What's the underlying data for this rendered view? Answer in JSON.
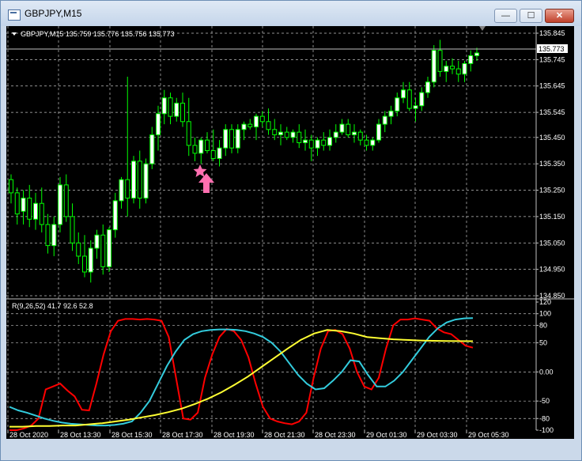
{
  "window": {
    "title": "GBPJPY,M15",
    "minimize_glyph": "—",
    "maximize_glyph": "☐",
    "close_glyph": "✕",
    "icon": "chart-window-icon"
  },
  "price_panel": {
    "header": "GBPJPY,M15  135.759 135.776 135.756 135.773",
    "current_price": "135.773",
    "y_ticks": [
      "135.845",
      "135.745",
      "135.645",
      "135.545",
      "135.450",
      "135.350",
      "135.250",
      "135.150",
      "135.050",
      "134.950",
      "134.850"
    ]
  },
  "indicator_panel": {
    "label": "R(9,26,52) 41.7 92.6 52.8",
    "y_ticks": [
      "120",
      "100",
      "80",
      "50",
      "0.00",
      "-50",
      "-80",
      "-100"
    ]
  },
  "time_axis": [
    "28 Oct 2020",
    "28 Oct 13:30",
    "28 Oct 15:30",
    "28 Oct 17:30",
    "28 Oct 19:30",
    "28 Oct 21:30",
    "28 Oct 23:30",
    "29 Oct 01:30",
    "29 Oct 03:30",
    "29 Oct 05:30"
  ],
  "colors": {
    "background": "#000000",
    "grid": "#c0c0c0",
    "candle": "#00ff00",
    "bull_body": "#ffffff",
    "bear_body": "#000000",
    "line_red": "#ff0000",
    "line_cyan": "#33ccdd",
    "line_yellow": "#ffff33",
    "signal": "#ff6fb0"
  },
  "markers": {
    "signal_star": "pink-star-marker",
    "signal_arrow": "pink-up-arrow"
  },
  "chart_data": {
    "type": "candlestick",
    "symbol": "GBPJPY",
    "timeframe": "M15",
    "ylim": [
      134.85,
      135.86
    ],
    "ohlc": [
      [
        135.29,
        135.31,
        135.2,
        135.24
      ],
      [
        135.24,
        135.26,
        135.12,
        135.16
      ],
      [
        135.17,
        135.25,
        135.12,
        135.22
      ],
      [
        135.22,
        135.27,
        135.11,
        135.14
      ],
      [
        135.14,
        135.24,
        135.1,
        135.2
      ],
      [
        135.2,
        135.26,
        135.09,
        135.12
      ],
      [
        135.12,
        135.16,
        135.01,
        135.04
      ],
      [
        135.04,
        135.15,
        135.0,
        135.12
      ],
      [
        135.12,
        135.3,
        135.09,
        135.27
      ],
      [
        135.27,
        135.31,
        135.13,
        135.15
      ],
      [
        135.15,
        135.2,
        135.02,
        135.05
      ],
      [
        135.05,
        135.09,
        134.97,
        135.0
      ],
      [
        135.0,
        135.08,
        134.92,
        134.94
      ],
      [
        134.94,
        135.06,
        134.9,
        135.03
      ],
      [
        135.03,
        135.1,
        134.99,
        135.08
      ],
      [
        135.08,
        135.12,
        134.93,
        134.96
      ],
      [
        134.96,
        135.11,
        134.94,
        135.1
      ],
      [
        135.1,
        135.24,
        135.07,
        135.21
      ],
      [
        135.21,
        135.3,
        135.18,
        135.29
      ],
      [
        135.29,
        135.68,
        135.15,
        135.22
      ],
      [
        135.22,
        135.38,
        135.2,
        135.36
      ],
      [
        135.36,
        135.4,
        135.18,
        135.22
      ],
      [
        135.22,
        135.37,
        135.2,
        135.35
      ],
      [
        135.35,
        135.49,
        135.33,
        135.46
      ],
      [
        135.46,
        135.57,
        135.4,
        135.54
      ],
      [
        135.54,
        135.63,
        135.5,
        135.6
      ],
      [
        135.6,
        135.62,
        135.5,
        135.53
      ],
      [
        135.53,
        135.6,
        135.51,
        135.58
      ],
      [
        135.58,
        135.62,
        135.49,
        135.51
      ],
      [
        135.51,
        135.6,
        135.38,
        135.42
      ],
      [
        135.42,
        135.45,
        135.36,
        135.39
      ],
      [
        135.39,
        135.45,
        135.35,
        135.44
      ],
      [
        135.44,
        135.47,
        135.39,
        135.4
      ],
      [
        135.4,
        135.48,
        135.36,
        135.37
      ],
      [
        135.37,
        135.44,
        135.34,
        135.41
      ],
      [
        135.41,
        135.5,
        135.38,
        135.48
      ],
      [
        135.48,
        135.5,
        135.39,
        135.41
      ],
      [
        135.41,
        135.5,
        135.39,
        135.48
      ],
      [
        135.48,
        135.51,
        135.44,
        135.5
      ],
      [
        135.5,
        135.52,
        135.48,
        135.49
      ],
      [
        135.49,
        135.54,
        135.44,
        135.53
      ],
      [
        135.53,
        135.55,
        135.49,
        135.51
      ],
      [
        135.51,
        135.56,
        135.46,
        135.48
      ],
      [
        135.48,
        135.52,
        135.44,
        135.46
      ],
      [
        135.46,
        135.5,
        135.42,
        135.47
      ],
      [
        135.47,
        135.49,
        135.44,
        135.45
      ],
      [
        135.45,
        135.48,
        135.43,
        135.47
      ],
      [
        135.47,
        135.5,
        135.41,
        135.43
      ],
      [
        135.43,
        135.48,
        135.4,
        135.44
      ],
      [
        135.44,
        135.46,
        135.36,
        135.41
      ],
      [
        135.41,
        135.45,
        135.38,
        135.44
      ],
      [
        135.44,
        135.47,
        135.4,
        135.42
      ],
      [
        135.42,
        135.48,
        135.4,
        135.45
      ],
      [
        135.45,
        135.5,
        135.43,
        135.47
      ],
      [
        135.47,
        135.52,
        135.46,
        135.5
      ],
      [
        135.5,
        135.52,
        135.45,
        135.46
      ],
      [
        135.46,
        135.5,
        135.43,
        135.47
      ],
      [
        135.47,
        135.48,
        135.42,
        135.44
      ],
      [
        135.44,
        135.46,
        135.4,
        135.42
      ],
      [
        135.42,
        135.45,
        135.4,
        135.44
      ],
      [
        135.44,
        135.52,
        135.43,
        135.5
      ],
      [
        135.5,
        135.55,
        135.47,
        135.53
      ],
      [
        135.53,
        135.57,
        135.5,
        135.55
      ],
      [
        135.55,
        135.62,
        135.53,
        135.6
      ],
      [
        135.6,
        135.66,
        135.58,
        135.63
      ],
      [
        135.63,
        135.66,
        135.55,
        135.56
      ],
      [
        135.56,
        135.6,
        135.51,
        135.57
      ],
      [
        135.57,
        135.64,
        135.55,
        135.62
      ],
      [
        135.62,
        135.68,
        135.6,
        135.66
      ],
      [
        135.66,
        135.8,
        135.64,
        135.78
      ],
      [
        135.78,
        135.82,
        135.68,
        135.7
      ],
      [
        135.7,
        135.74,
        135.66,
        135.72
      ],
      [
        135.72,
        135.75,
        135.69,
        135.71
      ],
      [
        135.71,
        135.74,
        135.66,
        135.69
      ],
      [
        135.69,
        135.74,
        135.66,
        135.73
      ],
      [
        135.73,
        135.78,
        135.7,
        135.76
      ],
      [
        135.76,
        135.79,
        135.74,
        135.77
      ]
    ],
    "indicator": {
      "name": "R(9,26,52)",
      "ylim": [
        -100,
        120
      ],
      "series": [
        {
          "name": "",
          "color": "#ff0000",
          "values": [
            -100,
            -100,
            -97,
            -92,
            -80,
            -30,
            -25,
            -20,
            -32,
            -42,
            -65,
            -66,
            -20,
            30,
            70,
            88,
            91,
            91,
            90,
            91,
            90,
            88,
            60,
            -10,
            -80,
            -82,
            -70,
            -10,
            30,
            60,
            74,
            70,
            55,
            25,
            -20,
            -60,
            -80,
            -85,
            -88,
            -90,
            -85,
            -70,
            -10,
            40,
            70,
            72,
            65,
            40,
            0,
            -25,
            -30,
            -10,
            40,
            80,
            90,
            90,
            92,
            90,
            88,
            75,
            68,
            65,
            55,
            45,
            41.7
          ]
        },
        {
          "name": "",
          "color": "#33ccdd",
          "values": [
            -60,
            -66,
            -70,
            -75,
            -80,
            -84,
            -87,
            -89,
            -90,
            -91,
            -92,
            -92,
            -91,
            -89,
            -85,
            -70,
            -50,
            -20,
            10,
            35,
            55,
            65,
            70,
            72,
            73,
            73,
            72,
            70,
            66,
            60,
            50,
            35,
            15,
            -5,
            -20,
            -30,
            -28,
            -15,
            0,
            20,
            18,
            -5,
            -25,
            -25,
            -15,
            0,
            20,
            40,
            60,
            75,
            85,
            90,
            92,
            92.6
          ]
        },
        {
          "name": "",
          "color": "#ffff33",
          "values": [
            -94,
            -94,
            -93,
            -93,
            -92,
            -92,
            -90,
            -88,
            -85,
            -82,
            -78,
            -74,
            -69,
            -63,
            -55,
            -46,
            -35,
            -22,
            -8,
            8,
            24,
            40,
            55,
            66,
            72,
            70,
            66,
            60,
            58,
            56,
            55,
            54,
            53.5,
            53,
            52.9,
            52.8
          ]
        }
      ]
    }
  }
}
